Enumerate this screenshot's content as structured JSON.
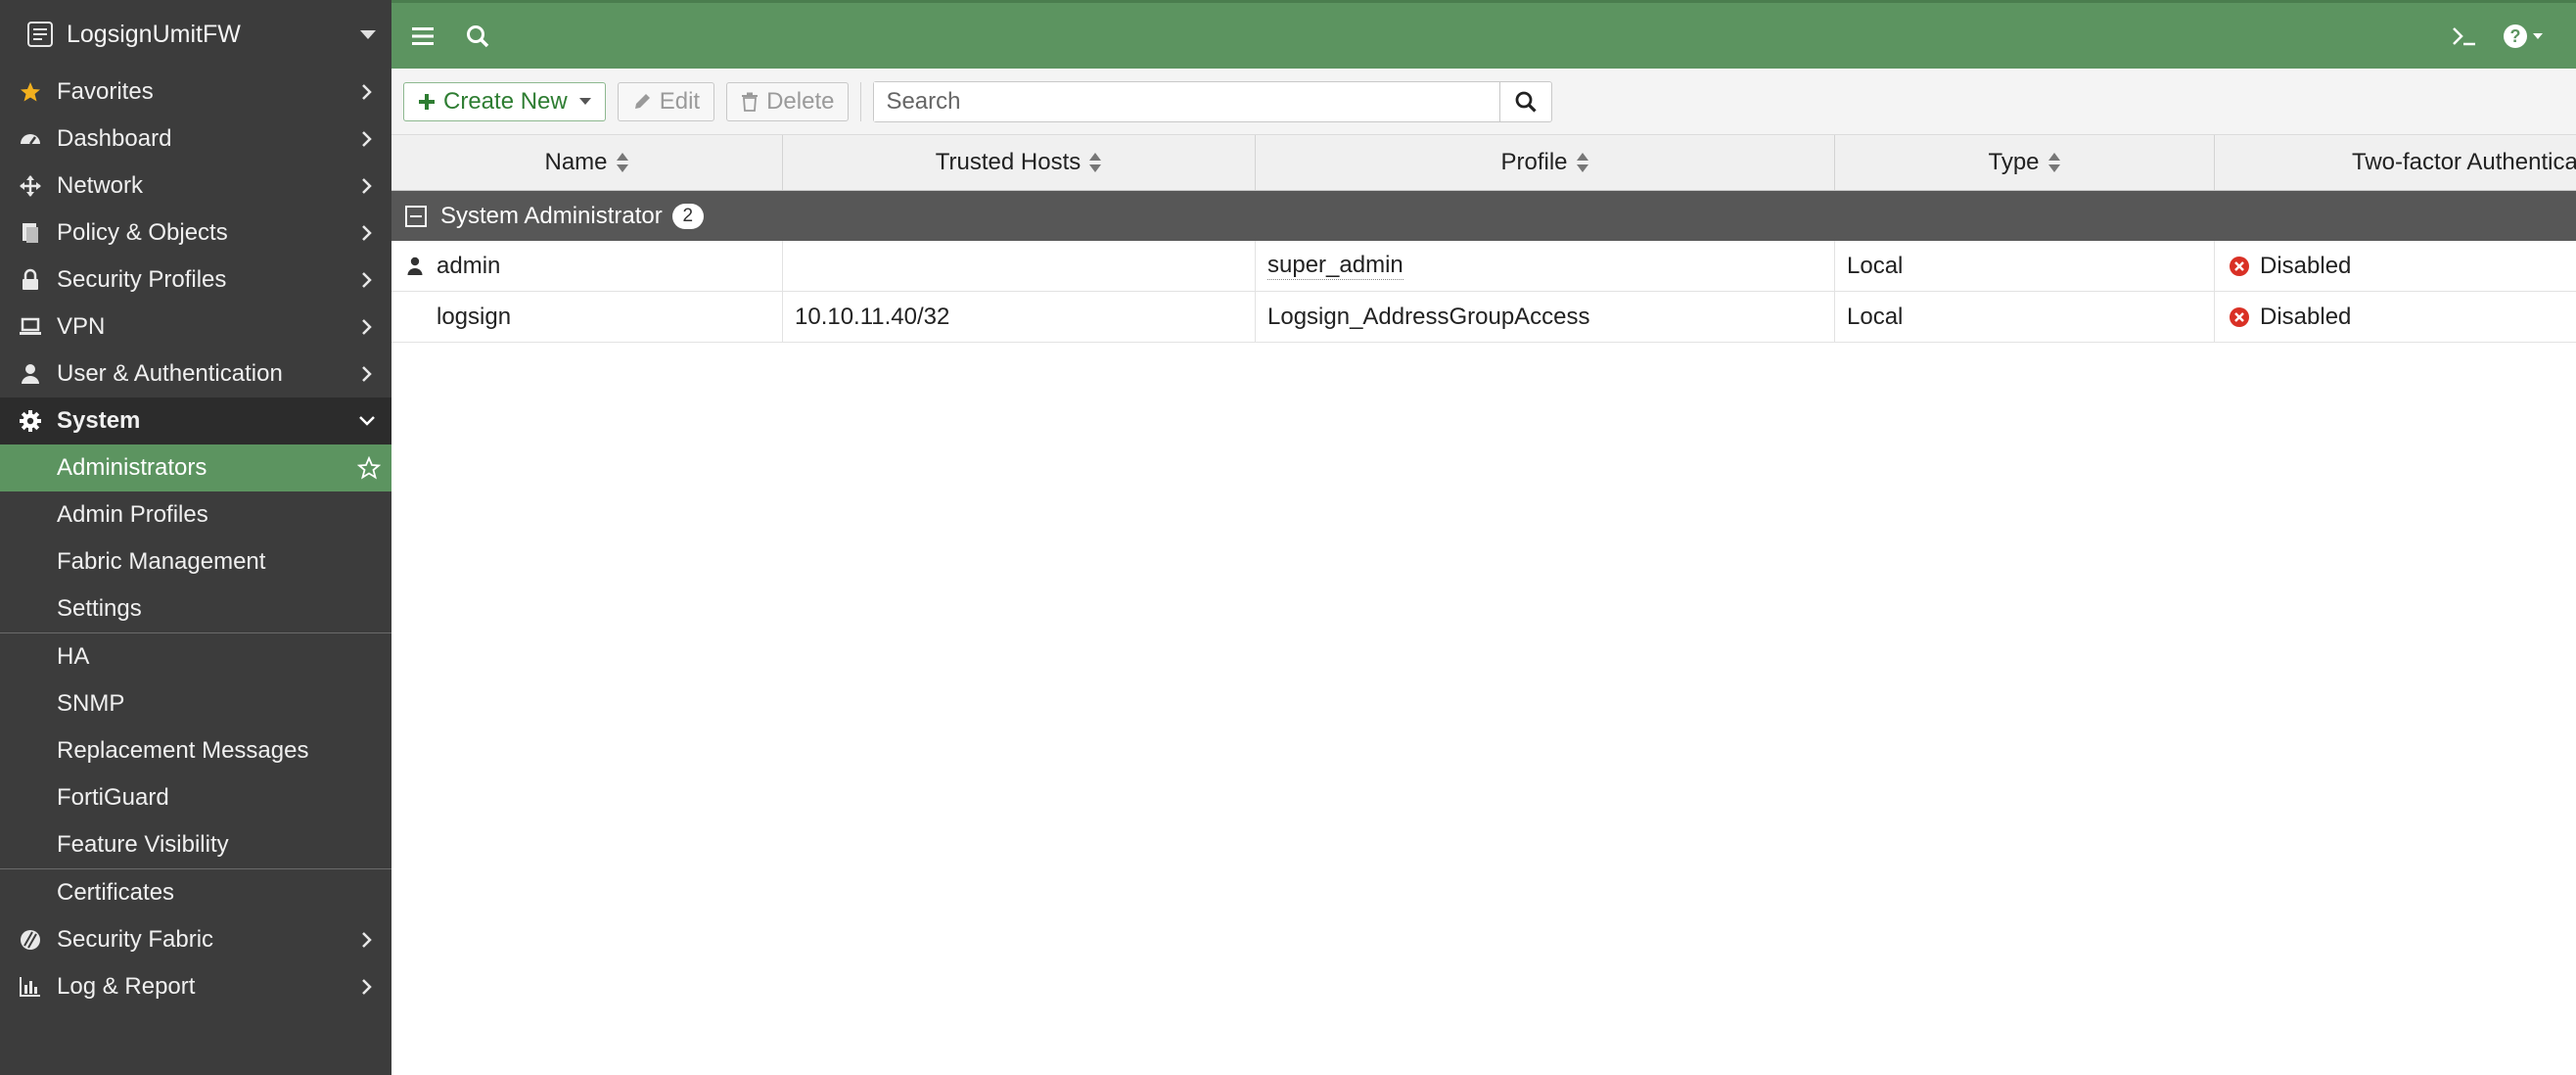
{
  "sidebar": {
    "hostname": "LogsignUmitFW",
    "items": [
      {
        "label": "Favorites",
        "icon": "star-icon"
      },
      {
        "label": "Dashboard",
        "icon": "dashboard-icon"
      },
      {
        "label": "Network",
        "icon": "network-icon"
      },
      {
        "label": "Policy & Objects",
        "icon": "policy-icon"
      },
      {
        "label": "Security Profiles",
        "icon": "lock-icon"
      },
      {
        "label": "VPN",
        "icon": "laptop-icon"
      },
      {
        "label": "User & Authentication",
        "icon": "user-icon"
      },
      {
        "label": "System",
        "icon": "gear-icon"
      }
    ],
    "system_subitems": [
      {
        "label": "Administrators"
      },
      {
        "label": "Admin Profiles"
      },
      {
        "label": "Fabric Management"
      },
      {
        "label": "Settings"
      },
      {
        "label": "HA"
      },
      {
        "label": "SNMP"
      },
      {
        "label": "Replacement Messages"
      },
      {
        "label": "FortiGuard"
      },
      {
        "label": "Feature Visibility"
      },
      {
        "label": "Certificates"
      }
    ],
    "bottom_items": [
      {
        "label": "Security Fabric",
        "icon": "security-fabric-icon"
      },
      {
        "label": "Log & Report",
        "icon": "chart-icon"
      }
    ]
  },
  "toolbar": {
    "create_label": "Create New",
    "edit_label": "Edit",
    "delete_label": "Delete",
    "search_placeholder": "Search"
  },
  "table": {
    "columns": [
      "Name",
      "Trusted Hosts",
      "Profile",
      "Type",
      "Two-factor Authentication"
    ],
    "group": {
      "label": "System Administrator",
      "count": "2"
    },
    "rows": [
      {
        "name": "admin",
        "trusted_hosts": "",
        "profile": "super_admin",
        "type": "Local",
        "two_factor": "Disabled"
      },
      {
        "name": "logsign",
        "trusted_hosts": "10.10.11.40/32",
        "profile": "Logsign_AddressGroupAccess",
        "type": "Local",
        "two_factor": "Disabled"
      }
    ]
  },
  "colors": {
    "accent_green": "#5c9460",
    "sidebar_bg": "#3c3c3c",
    "group_row_bg": "#575757",
    "status_disabled": "#d93025"
  }
}
